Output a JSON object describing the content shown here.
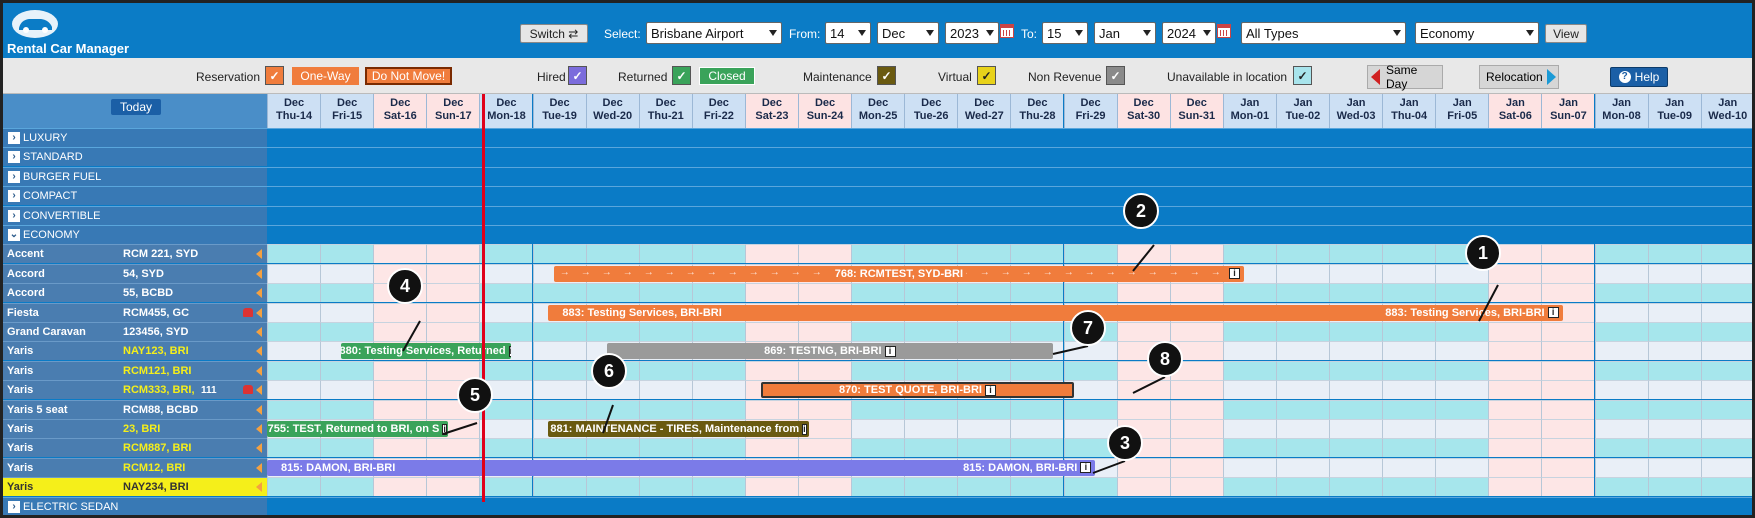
{
  "header": {
    "app_title": "Rental Car Manager",
    "switch_label": "Switch ⇄",
    "select_label": "Select:",
    "location": "Brisbane Airport",
    "from_label": "From:",
    "from_day": "14",
    "from_month": "Dec",
    "from_year": "2023",
    "to_label": "To:",
    "to_day": "15",
    "to_month": "Jan",
    "to_year": "2024",
    "type_filter": "All Types",
    "class_filter": "Economy",
    "view_label": "View"
  },
  "legend": {
    "reservation": "Reservation",
    "one_way": "One-Way",
    "do_not_move": "Do Not Move!",
    "hired": "Hired",
    "returned": "Returned",
    "closed": "Closed",
    "maintenance": "Maintenance",
    "virtual": "Virtual",
    "non_revenue": "Non Revenue",
    "unavailable": "Unavailable in location",
    "same_day": "Same Day",
    "relocation": "Relocation",
    "help": "Help",
    "colors": {
      "reservation": "#f07c3c",
      "hired": "#7b6cdc",
      "returned": "#3aa35a",
      "maintenance": "#6a5a10",
      "virtual": "#e8d21a",
      "non_revenue": "#8a8a8a",
      "unavailable": "#a8e4ec"
    }
  },
  "grid": {
    "today_label": "Today",
    "dates": [
      {
        "m": "Dec",
        "d": "Thu-14",
        "we": false
      },
      {
        "m": "Dec",
        "d": "Fri-15",
        "we": false
      },
      {
        "m": "Dec",
        "d": "Sat-16",
        "we": true
      },
      {
        "m": "Dec",
        "d": "Sun-17",
        "we": true
      },
      {
        "m": "Dec",
        "d": "Mon-18",
        "we": false
      },
      {
        "m": "Dec",
        "d": "Tue-19",
        "we": false
      },
      {
        "m": "Dec",
        "d": "Wed-20",
        "we": false
      },
      {
        "m": "Dec",
        "d": "Thu-21",
        "we": false
      },
      {
        "m": "Dec",
        "d": "Fri-22",
        "we": false
      },
      {
        "m": "Dec",
        "d": "Sat-23",
        "we": true
      },
      {
        "m": "Dec",
        "d": "Sun-24",
        "we": true
      },
      {
        "m": "Dec",
        "d": "Mon-25",
        "we": false
      },
      {
        "m": "Dec",
        "d": "Tue-26",
        "we": false
      },
      {
        "m": "Dec",
        "d": "Wed-27",
        "we": false
      },
      {
        "m": "Dec",
        "d": "Thu-28",
        "we": false
      },
      {
        "m": "Dec",
        "d": "Fri-29",
        "we": false
      },
      {
        "m": "Dec",
        "d": "Sat-30",
        "we": true
      },
      {
        "m": "Dec",
        "d": "Sun-31",
        "we": true
      },
      {
        "m": "Jan",
        "d": "Mon-01",
        "we": false
      },
      {
        "m": "Jan",
        "d": "Tue-02",
        "we": false
      },
      {
        "m": "Jan",
        "d": "Wed-03",
        "we": false
      },
      {
        "m": "Jan",
        "d": "Thu-04",
        "we": false
      },
      {
        "m": "Jan",
        "d": "Fri-05",
        "we": false
      },
      {
        "m": "Jan",
        "d": "Sat-06",
        "we": true
      },
      {
        "m": "Jan",
        "d": "Sun-07",
        "we": true
      },
      {
        "m": "Jan",
        "d": "Mon-08",
        "we": false
      },
      {
        "m": "Jan",
        "d": "Tue-09",
        "we": false
      },
      {
        "m": "Jan",
        "d": "Wed-10",
        "we": false
      }
    ],
    "categories_top": [
      "LUXURY",
      "STANDARD",
      "BURGER FUEL",
      "COMPACT",
      "CONVERTIBLE",
      "ECONOMY"
    ],
    "category_bottom": "ELECTRIC SEDAN",
    "vehicles": [
      {
        "model": "Accent",
        "rego": "RCM 221, SYD",
        "hl": false,
        "car": false,
        "extra": ""
      },
      {
        "model": "Accord",
        "rego": "54, SYD",
        "hl": false,
        "car": false,
        "extra": ""
      },
      {
        "model": "Accord",
        "rego": "55, BCBD",
        "hl": false,
        "car": false,
        "extra": ""
      },
      {
        "model": "Fiesta",
        "rego": "RCM455, GC",
        "hl": false,
        "car": true,
        "extra": ""
      },
      {
        "model": "Grand Caravan",
        "rego": "123456, SYD",
        "hl": false,
        "car": false,
        "extra": ""
      },
      {
        "model": "Yaris",
        "rego": "NAY123, BRI",
        "hl": false,
        "car": false,
        "extra": "",
        "yel": true
      },
      {
        "model": "Yaris",
        "rego": "RCM121, BRI",
        "hl": false,
        "car": false,
        "extra": "",
        "yel": true
      },
      {
        "model": "Yaris",
        "rego": "RCM333, BRI,",
        "hl": false,
        "car": true,
        "extra": "111",
        "yel": true
      },
      {
        "model": "Yaris 5 seat",
        "rego": "RCM88, BCBD",
        "hl": false,
        "car": false,
        "extra": ""
      },
      {
        "model": "Yaris",
        "rego": "23, BRI",
        "hl": false,
        "car": false,
        "extra": "",
        "yel": true
      },
      {
        "model": "Yaris",
        "rego": "RCM887, BRI",
        "hl": false,
        "car": false,
        "extra": "",
        "yel": true
      },
      {
        "model": "Yaris",
        "rego": "RCM12, BRI",
        "hl": false,
        "car": false,
        "extra": "",
        "yel": true
      },
      {
        "model": "Yaris",
        "rego": "NAY234, BRI",
        "hl": true,
        "car": false,
        "extra": ""
      }
    ],
    "bookings": [
      {
        "id": "b768",
        "row": 1,
        "start": 5.4,
        "end": 18.4,
        "text": "768: RCMTEST, SYD-BRI",
        "color": "#f07c3c",
        "arrows": true
      },
      {
        "id": "b883",
        "row": 3,
        "start": 5.3,
        "end": 24.4,
        "text": "883: Testing Services, BRI-BRI",
        "text2": "883: Testing Services, BRI-BRI",
        "color": "#f07c3c"
      },
      {
        "id": "b880",
        "row": 5,
        "start": 1.4,
        "end": 4.6,
        "text": "880: Testing Services, Returned",
        "color": "#3aa35a"
      },
      {
        "id": "b869",
        "row": 5,
        "start": 6.4,
        "end": 14.8,
        "text": "869: TESTNG, BRI-BRI",
        "color": "#9a9a9a"
      },
      {
        "id": "b870",
        "row": 7,
        "start": 9.3,
        "end": 15.2,
        "text": "870: TEST QUOTE, BRI-BRI",
        "color": "#f07c3c",
        "outline": true
      },
      {
        "id": "b755",
        "row": 9,
        "start": 0,
        "end": 3.4,
        "text": "755: TEST, Returned to BRI, on S",
        "color": "#3aa35a"
      },
      {
        "id": "b881",
        "row": 9,
        "start": 5.3,
        "end": 10.2,
        "text": "881: MAINTENANCE - TIRES, Maintenance from",
        "color": "#6a5a10"
      },
      {
        "id": "b815",
        "row": 11,
        "start": 0,
        "end": 15.6,
        "text": "815: DAMON, BRI-BRI",
        "text2": "815: DAMON, BRI-BRI",
        "color": "#7b7be8"
      }
    ],
    "callouts": [
      "1",
      "2",
      "3",
      "4",
      "5",
      "6",
      "7",
      "8"
    ]
  }
}
